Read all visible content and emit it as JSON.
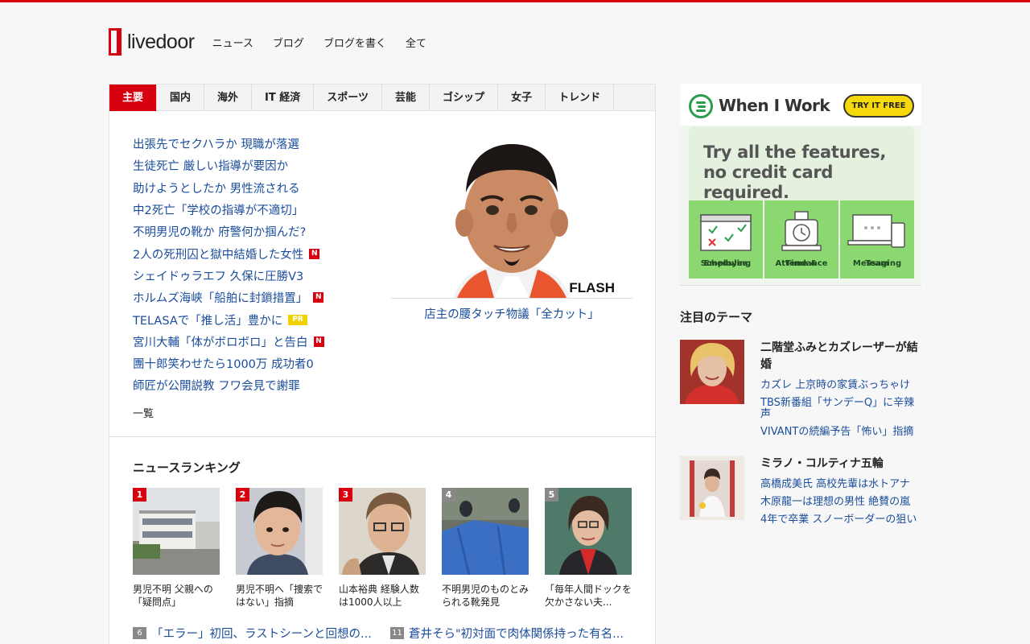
{
  "header": {
    "logo_text": "livedoor",
    "nav": [
      "ニュース",
      "ブログ",
      "ブログを書く",
      "全て"
    ]
  },
  "tabs": [
    "主要",
    "国内",
    "海外",
    "IT 経済",
    "スポーツ",
    "芸能",
    "ゴシップ",
    "女子",
    "トレンド"
  ],
  "topics": [
    {
      "text": "出張先でセクハラか 現職が落選",
      "badge": ""
    },
    {
      "text": "生徒死亡 厳しい指導が要因か",
      "badge": ""
    },
    {
      "text": "助けようとしたか 男性流される",
      "badge": ""
    },
    {
      "text": "中2死亡「学校の指導が不適切」",
      "badge": ""
    },
    {
      "text": "不明男児の靴か 府警何か掴んだ?",
      "badge": ""
    },
    {
      "text": "2人の死刑囚と獄中結婚した女性",
      "badge": "N"
    },
    {
      "text": "シェイドゥラエフ 久保に圧勝V3",
      "badge": ""
    },
    {
      "text": "ホルムズ海峡「船舶に封鎖措置」",
      "badge": "N"
    },
    {
      "text": "TELASAで「推し活」豊かに",
      "badge": "PR"
    },
    {
      "text": "宮川大輔「体がボロボロ」と告白",
      "badge": "N"
    },
    {
      "text": "團十郎笑わせたら1000万 成功者0",
      "badge": ""
    },
    {
      "text": "師匠が公開説教 フワ会見で謝罪",
      "badge": ""
    }
  ],
  "topics_more": "一覧",
  "feature": {
    "caption": "店主の腰タッチ物議「全カット」",
    "watermark": "FLASH"
  },
  "ranking": {
    "title": "ニュースランキング",
    "items": [
      {
        "num": "1",
        "text": "男児不明 父親への「疑問点」"
      },
      {
        "num": "2",
        "text": "男児不明へ「捜索ではない」指摘"
      },
      {
        "num": "3",
        "text": "山本裕典 経験人数は1000人以上"
      },
      {
        "num": "4",
        "text": "不明男児のものとみられる靴発見"
      },
      {
        "num": "5",
        "text": "「毎年人間ドックを欠かさない夫..."
      }
    ],
    "list": [
      {
        "num": "6",
        "text": "「エラー」初回、ラストシーンと回想の..."
      },
      {
        "num": "11",
        "text": "蒼井そら\"初対面で肉体関係持った有名..."
      }
    ]
  },
  "ad": {
    "brand": "When I Work",
    "cta": "TRY IT FREE",
    "headline_1": "Try all the features,",
    "headline_2": "no credit card required.",
    "tiles": [
      {
        "line1": "Employee",
        "line2": "Scheduling"
      },
      {
        "line1": "Time &",
        "line2": "Attendance"
      },
      {
        "line1": "Team",
        "line2": "Messaging"
      }
    ]
  },
  "themes": {
    "title": "注目のテーマ",
    "items": [
      {
        "title": "二階堂ふみとカズレーザーが結婚",
        "links": [
          "カズレ 上京時の家賃ぶっちゃけ",
          "TBS新番組「サンデーQ」に辛辣声",
          "VIVANTの続編予告「怖い」指摘"
        ]
      },
      {
        "title": "ミラノ・コルティナ五輪",
        "links": [
          "高橋成美氏 高校先輩は水トアナ",
          "木原龍一は理想の男性 絶賛の嵐",
          "4年で卒業 スノーボーダーの狙い"
        ]
      }
    ]
  },
  "colors": {
    "brand": "#d7000f",
    "link": "#1a4d9c"
  }
}
